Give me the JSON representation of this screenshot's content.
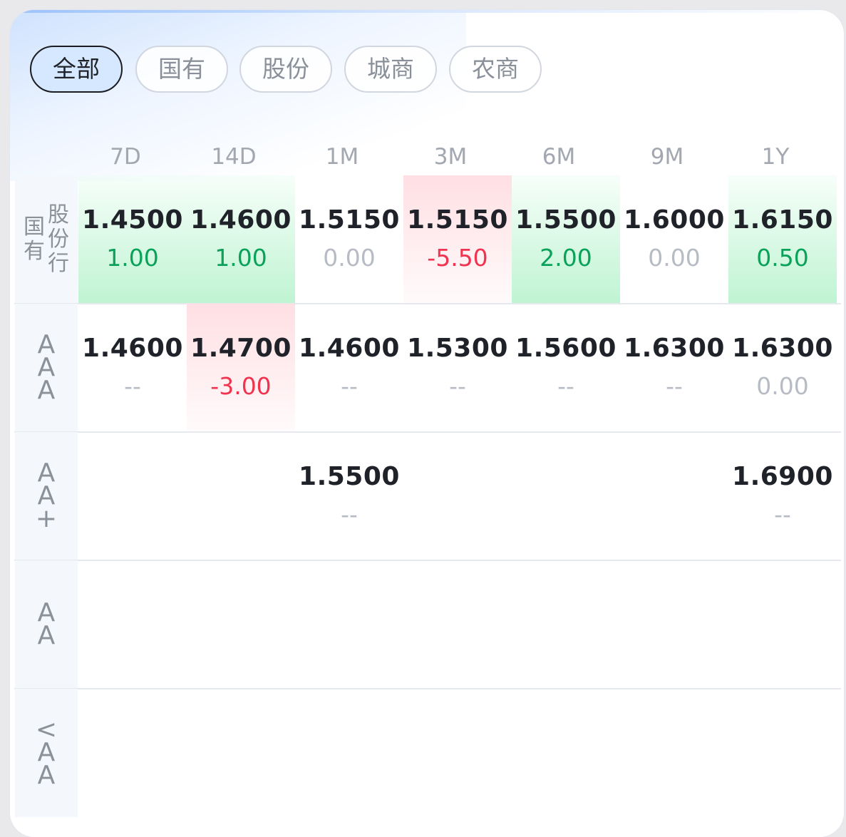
{
  "filters": [
    {
      "label": "全部",
      "active": true
    },
    {
      "label": "国有",
      "active": false
    },
    {
      "label": "股份",
      "active": false
    },
    {
      "label": "城商",
      "active": false
    },
    {
      "label": "农商",
      "active": false
    }
  ],
  "columns": [
    "7D",
    "14D",
    "1M",
    "3M",
    "6M",
    "9M",
    "1Y"
  ],
  "rows": [
    {
      "label": "国有股份行",
      "cells": [
        {
          "price": "1.4500",
          "change": "1.00",
          "trend": "up"
        },
        {
          "price": "1.4600",
          "change": "1.00",
          "trend": "up"
        },
        {
          "price": "1.5150",
          "change": "0.00",
          "trend": "flat"
        },
        {
          "price": "1.5150",
          "change": "-5.50",
          "trend": "down"
        },
        {
          "price": "1.5500",
          "change": "2.00",
          "trend": "up"
        },
        {
          "price": "1.6000",
          "change": "0.00",
          "trend": "flat"
        },
        {
          "price": "1.6150",
          "change": "0.50",
          "trend": "up"
        }
      ]
    },
    {
      "label": "AAA",
      "cells": [
        {
          "price": "1.4600",
          "change": "--",
          "trend": "none"
        },
        {
          "price": "1.4700",
          "change": "-3.00",
          "trend": "down"
        },
        {
          "price": "1.4600",
          "change": "--",
          "trend": "none"
        },
        {
          "price": "1.5300",
          "change": "--",
          "trend": "none"
        },
        {
          "price": "1.5600",
          "change": "--",
          "trend": "none"
        },
        {
          "price": "1.6300",
          "change": "--",
          "trend": "none"
        },
        {
          "price": "1.6300",
          "change": "0.00",
          "trend": "flat"
        }
      ]
    },
    {
      "label": "AA+",
      "cells": [
        {
          "price": "",
          "change": "",
          "trend": "none"
        },
        {
          "price": "",
          "change": "",
          "trend": "none"
        },
        {
          "price": "1.5500",
          "change": "--",
          "trend": "none"
        },
        {
          "price": "",
          "change": "",
          "trend": "none"
        },
        {
          "price": "",
          "change": "",
          "trend": "none"
        },
        {
          "price": "",
          "change": "",
          "trend": "none"
        },
        {
          "price": "1.6900",
          "change": "--",
          "trend": "none"
        }
      ]
    },
    {
      "label": "AA",
      "cells": [
        {
          "price": "",
          "change": "",
          "trend": "none"
        },
        {
          "price": "",
          "change": "",
          "trend": "none"
        },
        {
          "price": "",
          "change": "",
          "trend": "none"
        },
        {
          "price": "",
          "change": "",
          "trend": "none"
        },
        {
          "price": "",
          "change": "",
          "trend": "none"
        },
        {
          "price": "",
          "change": "",
          "trend": "none"
        },
        {
          "price": "",
          "change": "",
          "trend": "none"
        }
      ]
    },
    {
      "label": "<AA",
      "cells": [
        {
          "price": "",
          "change": "",
          "trend": "none"
        },
        {
          "price": "",
          "change": "",
          "trend": "none"
        },
        {
          "price": "",
          "change": "",
          "trend": "none"
        },
        {
          "price": "",
          "change": "",
          "trend": "none"
        },
        {
          "price": "",
          "change": "",
          "trend": "none"
        },
        {
          "price": "",
          "change": "",
          "trend": "none"
        },
        {
          "price": "",
          "change": "",
          "trend": "none"
        }
      ]
    }
  ],
  "colors": {
    "up": "#0aa25a",
    "down": "#f0334e",
    "flat": "#b7bcc4",
    "accent": "#d6e8ff"
  }
}
